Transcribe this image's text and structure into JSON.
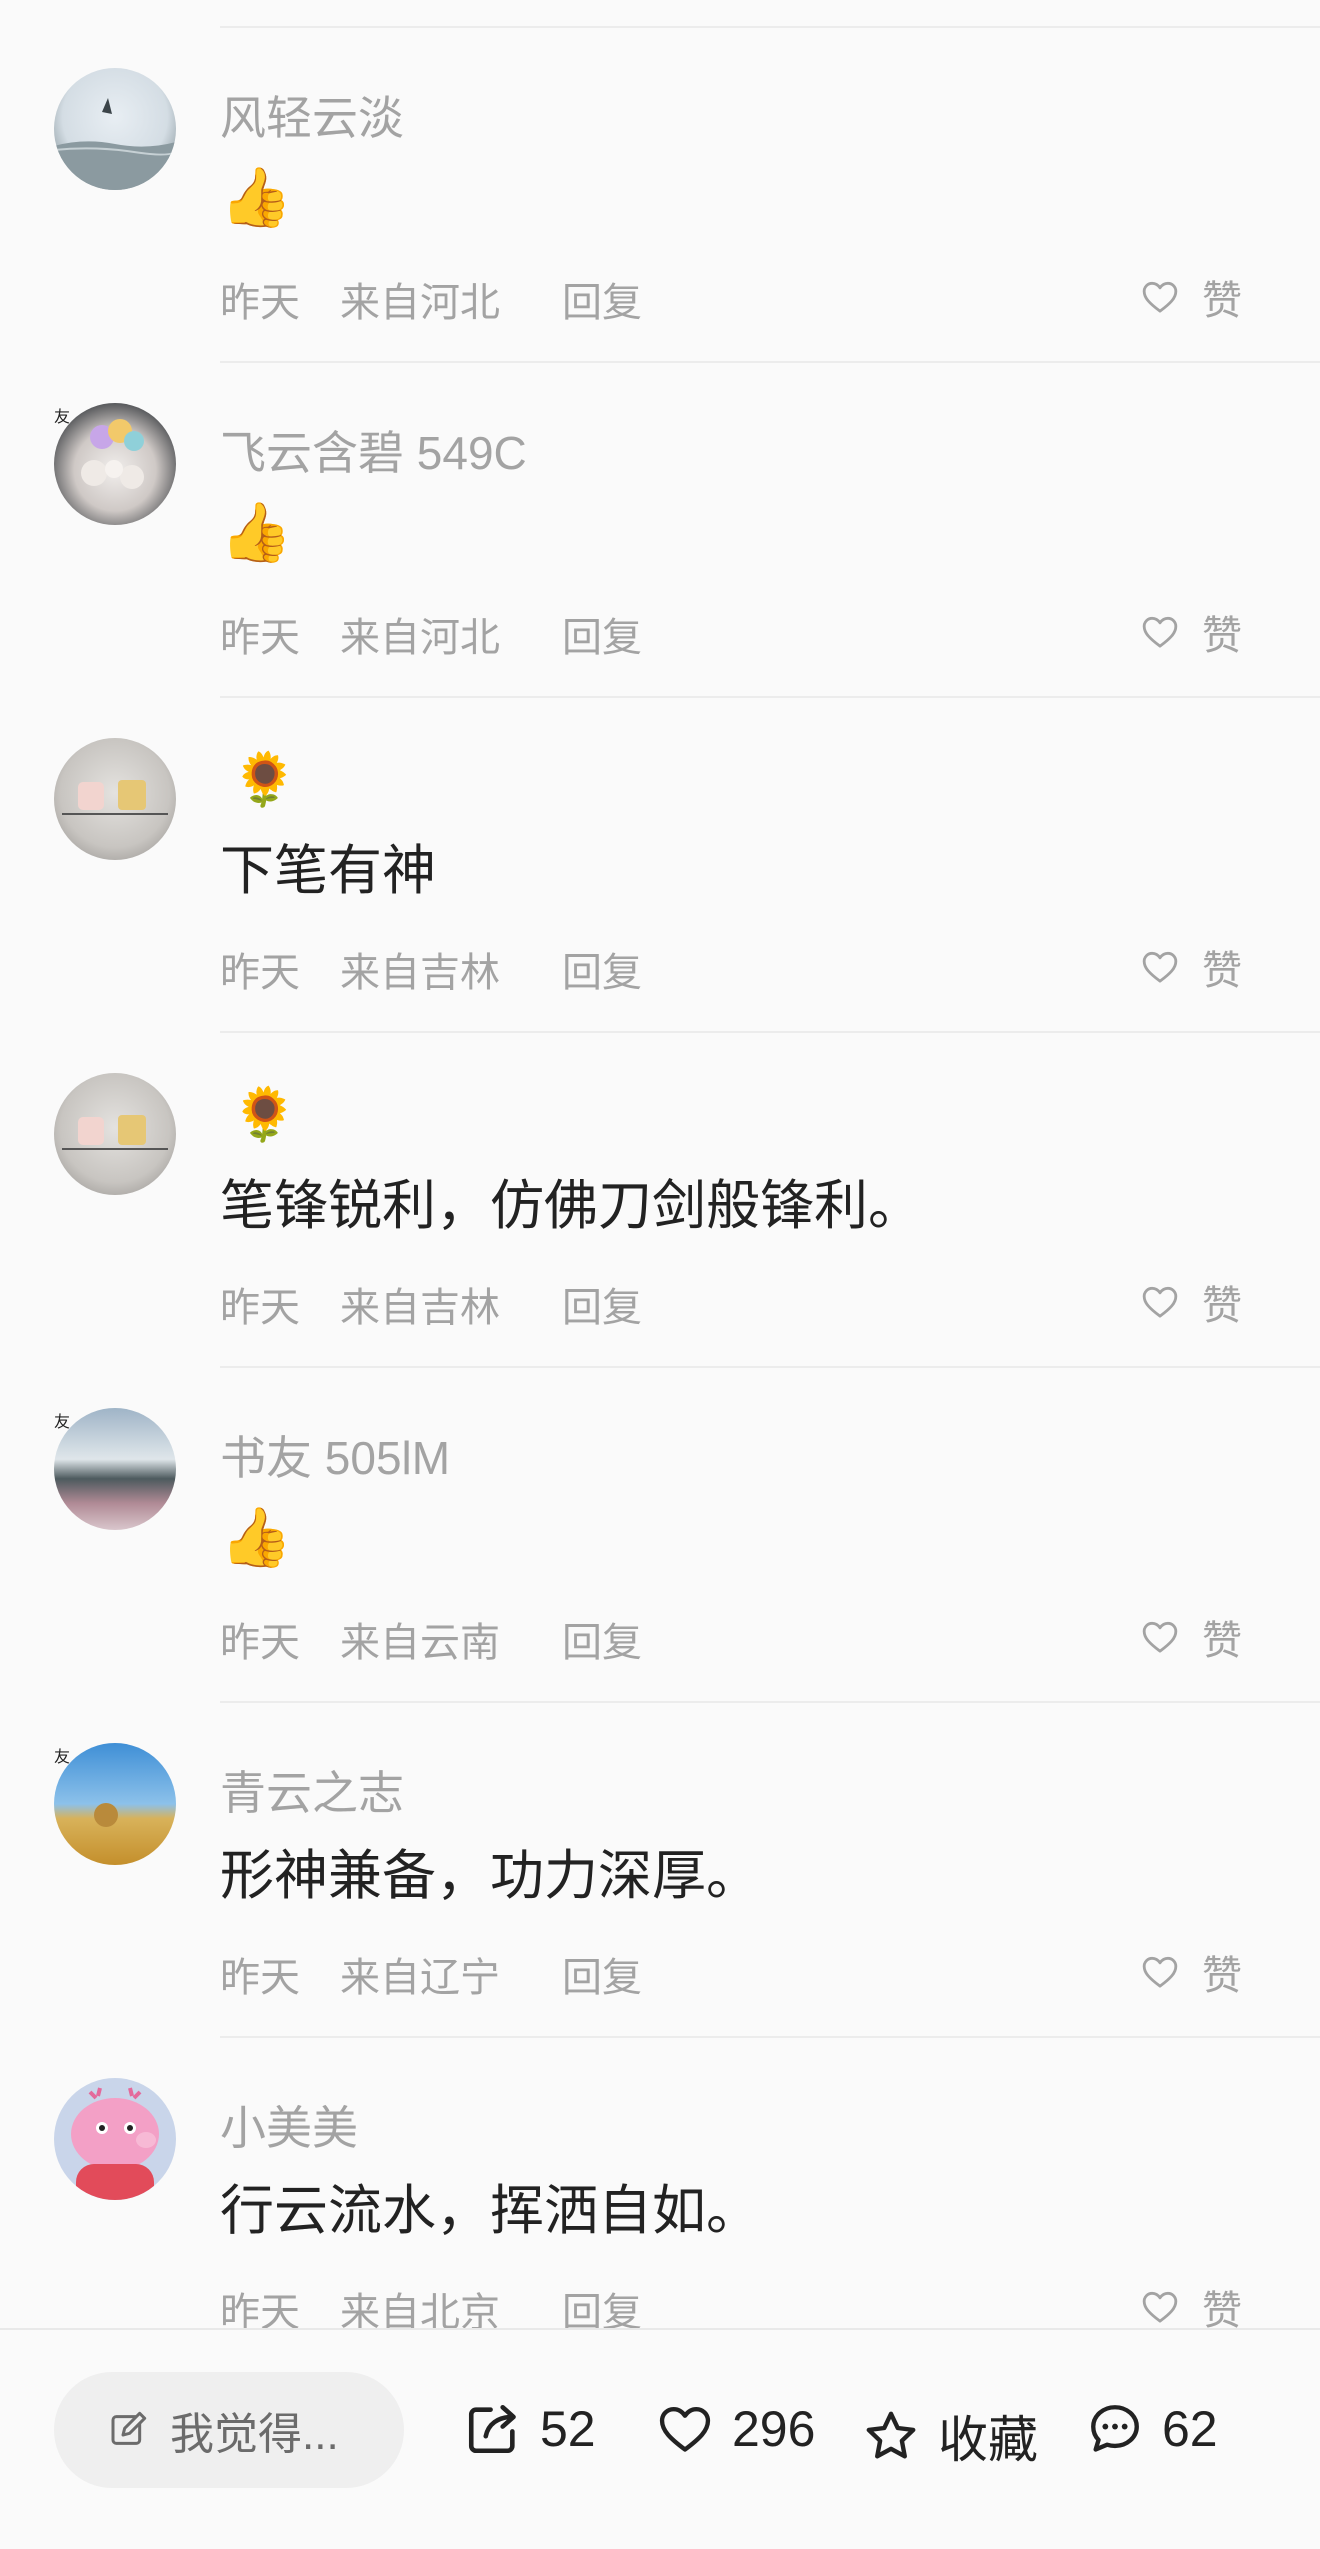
{
  "comments": [
    {
      "username": "风轻云淡",
      "emoji": "👍",
      "time": "昨天",
      "location": "来自河北",
      "reply": "回复",
      "like": "赞"
    },
    {
      "username": "飞云含碧 549C",
      "emoji": "👍",
      "time": "昨天",
      "location": "来自河北",
      "reply": "回复",
      "like": "赞"
    },
    {
      "username_emoji": "🌻",
      "text": "下笔有神",
      "time": "昨天",
      "location": "来自吉林",
      "reply": "回复",
      "like": "赞"
    },
    {
      "username_emoji": "🌻",
      "text": "笔锋锐利，仿佛刀剑般锋利。",
      "time": "昨天",
      "location": "来自吉林",
      "reply": "回复",
      "like": "赞"
    },
    {
      "username": "书友 505lM",
      "emoji": "👍",
      "time": "昨天",
      "location": "来自云南",
      "reply": "回复",
      "like": "赞"
    },
    {
      "username": "青云之志",
      "text": "形神兼备，功力深厚。",
      "time": "昨天",
      "location": "来自辽宁",
      "reply": "回复",
      "like": "赞"
    },
    {
      "username": "小美美",
      "text": "行云流水，挥洒自如。",
      "time": "昨天",
      "location": "来自北京",
      "reply": "回复",
      "like": "赞"
    }
  ],
  "bottom_bar": {
    "input_placeholder": "我觉得...",
    "share_count": "52",
    "like_count": "296",
    "favorite_label": "收藏",
    "comment_count": "62"
  },
  "colors": {
    "muted_text": "#a3a3a3",
    "badge": "#f5b32c",
    "background": "#fafafa"
  },
  "icons": [
    "thumbs-up-emoji",
    "sunflower-emoji",
    "heart-icon",
    "edit-icon",
    "share-icon",
    "star-icon",
    "comment-icon"
  ]
}
